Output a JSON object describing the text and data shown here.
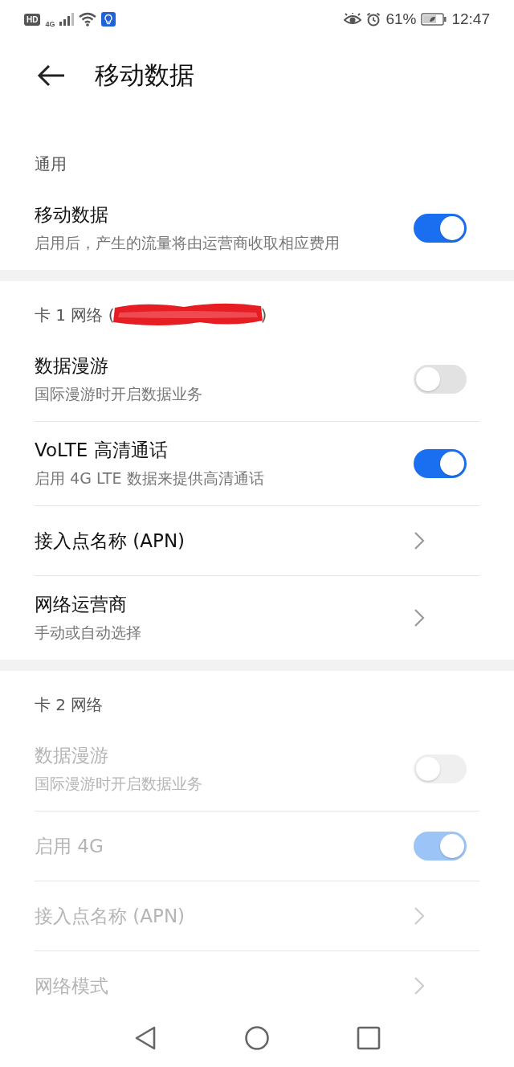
{
  "status_bar": {
    "hd_label": "HD",
    "network_label": "4G",
    "battery_percent": "61%",
    "time": "12:47"
  },
  "header": {
    "title": "移动数据"
  },
  "sections": [
    {
      "header": "通用",
      "redacted": false,
      "items": [
        {
          "kind": "toggle",
          "title": "移动数据",
          "subtitle": "启用后，产生的流量将由运营商收取相应费用",
          "on": true,
          "disabled": false
        }
      ]
    },
    {
      "header": "卡 1 网络 (",
      "header_end": ")",
      "redacted": true,
      "items": [
        {
          "kind": "toggle",
          "title": "数据漫游",
          "subtitle": "国际漫游时开启数据业务",
          "on": false,
          "disabled": false
        },
        {
          "kind": "toggle",
          "title": "VoLTE 高清通话",
          "subtitle": "启用 4G LTE 数据来提供高清通话",
          "on": true,
          "disabled": false
        },
        {
          "kind": "link",
          "title": "接入点名称 (APN)",
          "disabled": false
        },
        {
          "kind": "link",
          "title": "网络运营商",
          "subtitle": "手动或自动选择",
          "disabled": false
        }
      ]
    },
    {
      "header": "卡 2 网络",
      "redacted": false,
      "items": [
        {
          "kind": "toggle",
          "title": "数据漫游",
          "subtitle": "国际漫游时开启数据业务",
          "on": false,
          "disabled": true
        },
        {
          "kind": "toggle",
          "title": "启用 4G",
          "on": true,
          "disabled": true
        },
        {
          "kind": "link",
          "title": "接入点名称 (APN)",
          "disabled": true
        },
        {
          "kind": "link",
          "title": "网络模式",
          "disabled": true
        }
      ]
    }
  ]
}
